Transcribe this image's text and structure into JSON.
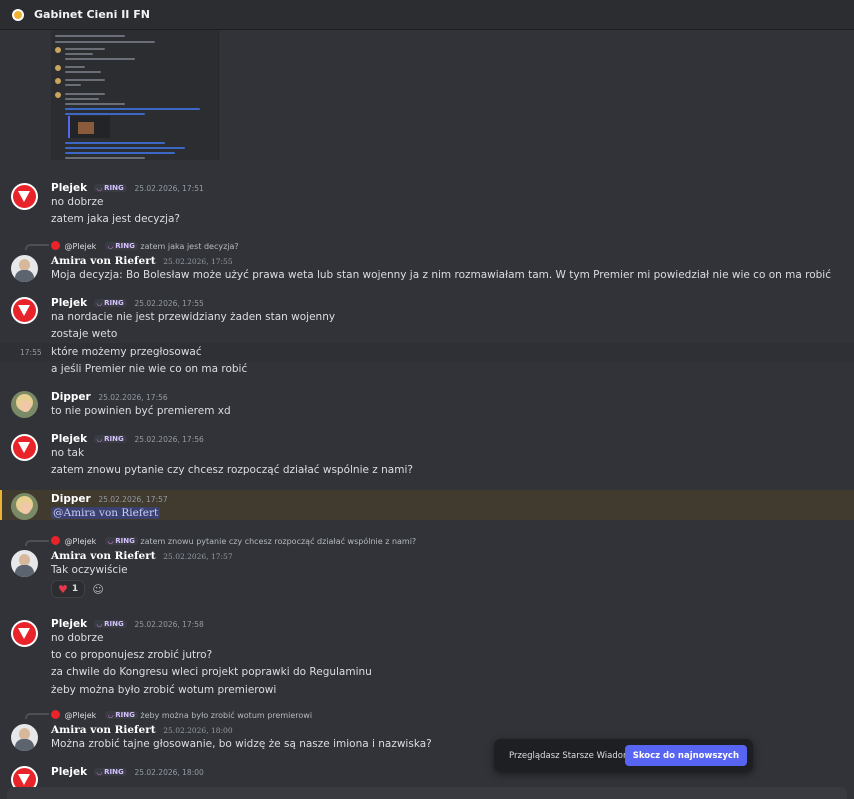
{
  "header": {
    "title": "Gabinet Cieni II FN"
  },
  "tag": {
    "label": "RING"
  },
  "messages": {
    "m1": {
      "author": "Plejek",
      "time": "25.02.2026, 17:51",
      "lines": [
        "no dobrze",
        "zatem jaka jest decyzja?"
      ]
    },
    "m2": {
      "reply_to": "@Plejek",
      "reply_text": "zatem jaka jest decyzja?",
      "author": "Amira von Riefert",
      "time": "25.02.2026, 17:55",
      "lines": [
        "Moja decyzja: Bo Bolesław może użyć prawa weta lub stan wojenny ja z nim rozmawiałam tam. W tym Premier mi powiedział nie wie co on ma robić"
      ]
    },
    "m3": {
      "author": "Plejek",
      "time": "25.02.2026, 17:55",
      "hover_time": "17:55",
      "lines": [
        "na nordacie nie jest przewidziany żaden stan wojenny",
        "zostaje weto",
        "które możemy przegłosować",
        "a jeśli Premier nie wie co on ma robić"
      ]
    },
    "m4": {
      "author": "Dipper",
      "time": "25.02.2026, 17:56",
      "lines": [
        "to nie powinien być premierem xd"
      ]
    },
    "m5": {
      "author": "Plejek",
      "time": "25.02.2026, 17:56",
      "lines": [
        "no tak",
        "zatem znowu pytanie czy chcesz rozpocząć działać wspólnie z nami?"
      ]
    },
    "m6": {
      "author": "Dipper",
      "time": "25.02.2026, 17:57",
      "mention": "@Amira von Riefert"
    },
    "m7": {
      "reply_to": "@Plejek",
      "reply_text": "zatem znowu pytanie czy chcesz rozpocząć działać wspólnie z nami?",
      "author": "Amira von Riefert",
      "time": "25.02.2026, 17:57",
      "lines": [
        "Tak oczywiście"
      ],
      "reaction_count": "1"
    },
    "m8": {
      "author": "Plejek",
      "time": "25.02.2026, 17:58",
      "lines": [
        "no dobrze",
        "to co proponujesz zrobić jutro?",
        "za chwile do Kongresu wleci projekt poprawki do Regulaminu",
        "żeby można było zrobić wotum premierowi"
      ]
    },
    "m9": {
      "reply_to": "@Plejek",
      "reply_text": "żeby można było zrobić wotum premierowi",
      "author": "Amira von Riefert",
      "time": "25.02.2026, 18:00",
      "lines": [
        "Można zrobić tajne głosowanie, bo widzę że są nasze imiona i nazwiska?"
      ]
    },
    "m10": {
      "author": "Plejek",
      "time": "25.02.2026, 18:00"
    }
  },
  "toast": {
    "text": "Przeglądasz Starsze Wiadomości",
    "button": "Skocz do najnowszych"
  },
  "colors": {
    "accent": "#5865f2",
    "highlight": "#f0b232",
    "tag_text": "#d4c0ff"
  },
  "icons": {
    "server": "server-icon",
    "heart": "heart-icon",
    "add_reaction": "add-reaction-icon"
  }
}
